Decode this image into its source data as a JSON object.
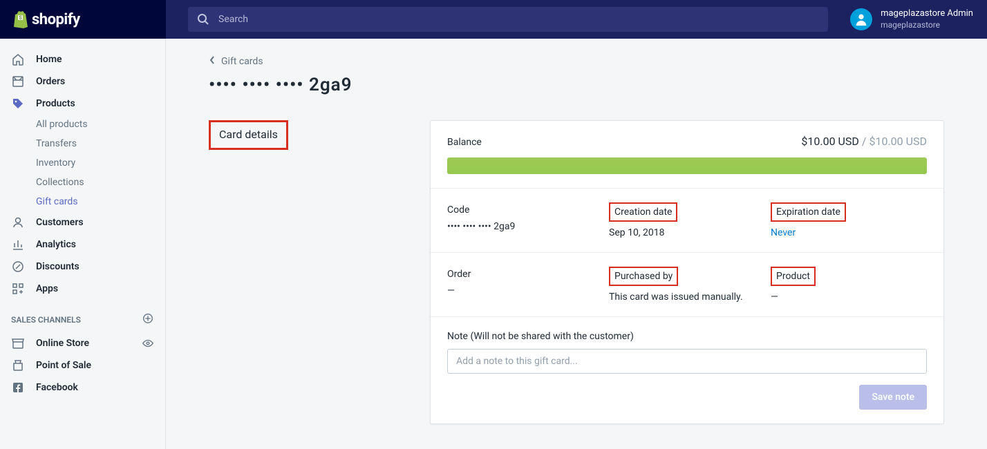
{
  "topbar": {
    "logo_text": "shopify",
    "search_placeholder": "Search",
    "user_name": "mageplazastore Admin",
    "store_name": "mageplazastore"
  },
  "sidebar": {
    "items": [
      {
        "label": "Home",
        "icon": "home"
      },
      {
        "label": "Orders",
        "icon": "orders"
      },
      {
        "label": "Products",
        "icon": "products",
        "subs": [
          {
            "label": "All products"
          },
          {
            "label": "Transfers"
          },
          {
            "label": "Inventory"
          },
          {
            "label": "Collections"
          },
          {
            "label": "Gift cards",
            "active": true
          }
        ]
      },
      {
        "label": "Customers",
        "icon": "customers"
      },
      {
        "label": "Analytics",
        "icon": "analytics"
      },
      {
        "label": "Discounts",
        "icon": "discounts"
      },
      {
        "label": "Apps",
        "icon": "apps"
      }
    ],
    "sales_channels_title": "SALES CHANNELS",
    "channels": [
      {
        "label": "Online Store",
        "icon": "store",
        "trailing": "eye"
      },
      {
        "label": "Point of Sale",
        "icon": "pos"
      },
      {
        "label": "Facebook",
        "icon": "fb"
      }
    ]
  },
  "page": {
    "back_label": "Gift cards",
    "title_masked": "•••• •••• •••• 2ga9",
    "section_title": "Card details"
  },
  "card": {
    "balance_label": "Balance",
    "balance_current": "$10.00 USD",
    "balance_sep": " / ",
    "balance_total": "$10.00 USD",
    "code_label": "Code",
    "code_value": "•••• •••• •••• 2ga9",
    "creation_date_label": "Creation date",
    "creation_date_value": "Sep 10, 2018",
    "expiration_date_label": "Expiration date",
    "expiration_date_value": "Never",
    "order_label": "Order",
    "order_value": "—",
    "purchased_by_label": "Purchased by",
    "purchased_by_value": "This card was issued manually.",
    "product_label": "Product",
    "product_value": "—",
    "note_label": "Note (Will not be shared with the customer)",
    "note_placeholder": "Add a note to this gift card...",
    "save_button": "Save note"
  }
}
